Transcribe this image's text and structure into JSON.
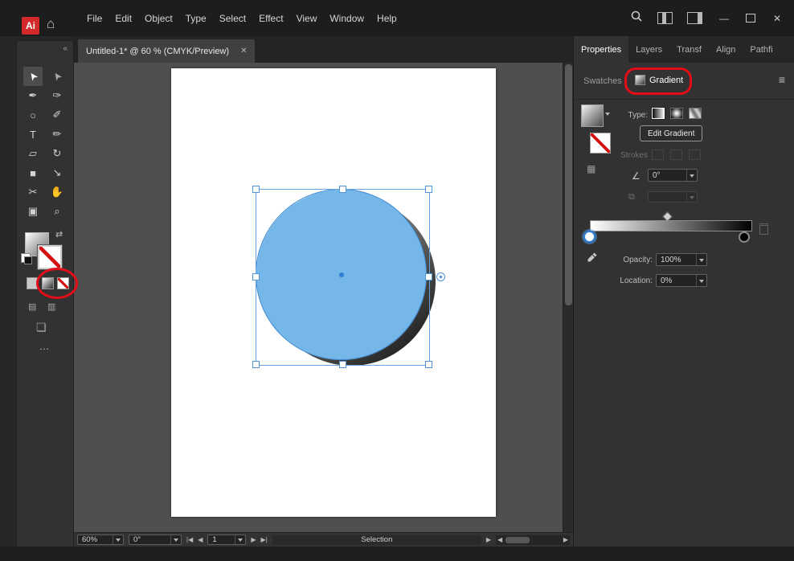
{
  "colors": {
    "annotation_red": "#e30d17",
    "logo_red": "#d22a2a",
    "circle_blue": "#74b7e8",
    "selection_blue": "#4f94d6",
    "artboard_white": "#ffffff",
    "gradient_start": "#ffffff",
    "gradient_end": "#000000"
  },
  "titlebar": {
    "logo": "Ai",
    "menus": [
      "File",
      "Edit",
      "Object",
      "Type",
      "Select",
      "Effect",
      "View",
      "Window",
      "Help"
    ],
    "minimize": "—",
    "close": "✕"
  },
  "doc_tab": {
    "title": "Untitled-1* @ 60 % (CMYK/Preview)",
    "close": "✕"
  },
  "toolbar": {
    "collapse": "«",
    "swap": "⇄",
    "more": "…",
    "tools": [
      {
        "name": "selection-tool",
        "glyph": "➤"
      },
      {
        "name": "direct-selection-tool",
        "glyph": "➤"
      },
      {
        "name": "pen-tool",
        "glyph": "✒"
      },
      {
        "name": "curvature-tool",
        "glyph": "✑"
      },
      {
        "name": "ellipse-tool",
        "glyph": "○"
      },
      {
        "name": "paintbrush-tool",
        "glyph": "✐"
      },
      {
        "name": "type-tool",
        "glyph": "T"
      },
      {
        "name": "pencil-tool",
        "glyph": "✏"
      },
      {
        "name": "eraser-tool",
        "glyph": "▱"
      },
      {
        "name": "rotate-tool",
        "glyph": "↻"
      },
      {
        "name": "rectangle-tool",
        "glyph": "■"
      },
      {
        "name": "eyedropper-tool",
        "glyph": "↘"
      },
      {
        "name": "scissors-tool",
        "glyph": "✂"
      },
      {
        "name": "hand-tool",
        "glyph": "✋"
      },
      {
        "name": "artboard-tool",
        "glyph": "▣"
      },
      {
        "name": "zoom-tool",
        "glyph": "⌕"
      }
    ],
    "draw_mode_a": "▤",
    "draw_mode_b": "▥",
    "artboard_icon": "❏"
  },
  "panel": {
    "tabs": [
      {
        "label": "Properties"
      },
      {
        "label": "Layers"
      },
      {
        "label": "Transf"
      },
      {
        "label": "Align"
      },
      {
        "label": "Pathfi"
      }
    ],
    "menu_icon": "≡",
    "swatches_label": "Swatches",
    "gradient_label": "Gradient",
    "type_label": "Type:",
    "edit_gradient_label": "Edit Gradient",
    "stroke_label": "Strokes",
    "angle_label": "∠",
    "angle_value": "0°",
    "opacity_label": "Opacity:",
    "opacity_value": "100%",
    "location_label": "Location:",
    "location_value": "0%",
    "gradient": {
      "type": "linear",
      "stops": [
        {
          "color": "#ffffff",
          "location": "0%",
          "selected": true
        },
        {
          "color": "#000000",
          "location": "100%",
          "selected": false
        }
      ],
      "midpoint": "50%"
    }
  },
  "statusbar": {
    "zoom": "60%",
    "angle": "0°",
    "artboard": "1",
    "mode": "Selection",
    "prev_all": "|◀",
    "prev": "◀",
    "next": "▶",
    "next_all": "▶|",
    "pane_arrow": "▶",
    "scroll_left": "◀",
    "scroll_right": "▶"
  }
}
